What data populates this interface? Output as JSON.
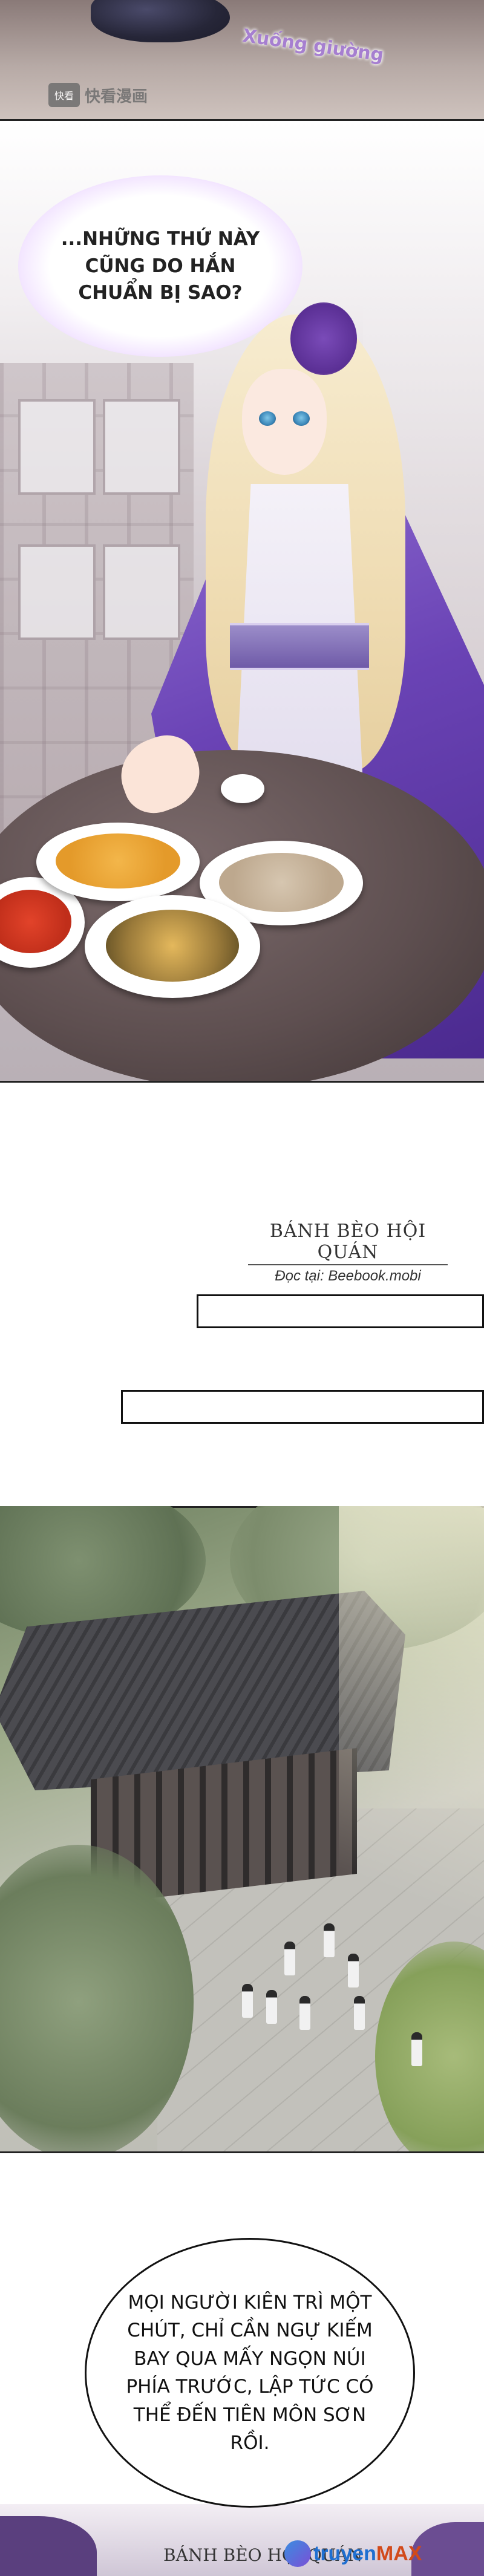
{
  "panel_top": {
    "sfx": "Xuống giường",
    "watermark_logo_icon": "kuaikan-logo-icon",
    "watermark_text": "快看漫画"
  },
  "panel_girl": {
    "thought": "...NHỮNG THỨ NÀY CŨNG DO HẮN CHUẨN BỊ SAO?"
  },
  "studio": {
    "name": "BÁNH BÈO HỘI QUÁN",
    "read_at": "Đọc tại: Beebook.mobi"
  },
  "panel_speech": {
    "text": "MỌI NGƯỜI KIÊN TRÌ MỘT CHÚT, CHỈ CẦN NGỰ KIẾM BAY QUA MẤY NGỌN NÚI PHÍA TRƯỚC, LẬP TỨC CÓ THỂ ĐẾN TIÊN MÔN SƠN RỒI."
  },
  "footer": {
    "studio_name": "BÁNH BÈO HỘI QUÁN",
    "site_prefix": "truyen",
    "site_suffix": "MAX"
  },
  "colors": {
    "robe_purple": "#6a43b5",
    "sfx_purple": "#a67fd0",
    "site_blue": "#1f6fd1",
    "site_orange": "#d24a1b"
  }
}
